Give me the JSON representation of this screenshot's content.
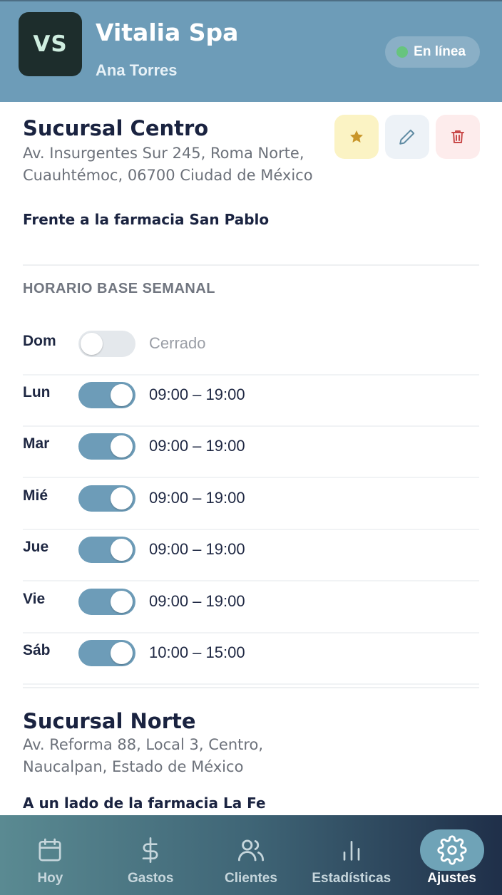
{
  "header": {
    "logo_initials": "VS",
    "business_name": "Vitalia Spa",
    "user_name": "Ana Torres",
    "status": "En línea"
  },
  "branches": [
    {
      "name": "Sucursal Centro",
      "address_line1": "Av. Insurgentes Sur 245, Roma Norte,",
      "address_line2": "Cuauhtémoc, 06700 Ciudad de México",
      "reference": "Frente a la farmacia San Pablo"
    },
    {
      "name": "Sucursal Norte",
      "address_line1": "Av. Reforma 88, Local 3, Centro,",
      "address_line2": "Naucalpan, Estado de México",
      "reference": "A un lado de la farmacia La Fe"
    }
  ],
  "schedule": {
    "title": "HORARIO BASE SEMANAL",
    "days": [
      {
        "day": "Dom",
        "enabled": false,
        "hours": "Cerrado"
      },
      {
        "day": "Lun",
        "enabled": true,
        "hours": "09:00 – 19:00"
      },
      {
        "day": "Mar",
        "enabled": true,
        "hours": "09:00 – 19:00"
      },
      {
        "day": "Mié",
        "enabled": true,
        "hours": "09:00 – 19:00"
      },
      {
        "day": "Jue",
        "enabled": true,
        "hours": "09:00 – 19:00"
      },
      {
        "day": "Vie",
        "enabled": true,
        "hours": "09:00 – 19:00"
      },
      {
        "day": "Sáb",
        "enabled": true,
        "hours": "10:00 – 15:00"
      }
    ]
  },
  "actions": {
    "favorite_icon": "star-icon",
    "edit_icon": "pencil-icon",
    "delete_icon": "trash-icon"
  },
  "nav": {
    "items": [
      {
        "label": "Hoy",
        "icon": "calendar-icon",
        "active": false
      },
      {
        "label": "Gastos",
        "icon": "dollar-icon",
        "active": false
      },
      {
        "label": "Clientes",
        "icon": "users-icon",
        "active": false
      },
      {
        "label": "Estadísticas",
        "icon": "bar-chart-icon",
        "active": false
      },
      {
        "label": "Ajustes",
        "icon": "gear-icon",
        "active": true
      }
    ]
  },
  "colors": {
    "header_bg": "#6d9cb8",
    "status_dot": "#67c47e",
    "toggle_on": "#6d9cb8",
    "favorite_bg": "#fbf3c4",
    "favorite_icon": "#c9962a",
    "delete_icon": "#c94a4a"
  }
}
